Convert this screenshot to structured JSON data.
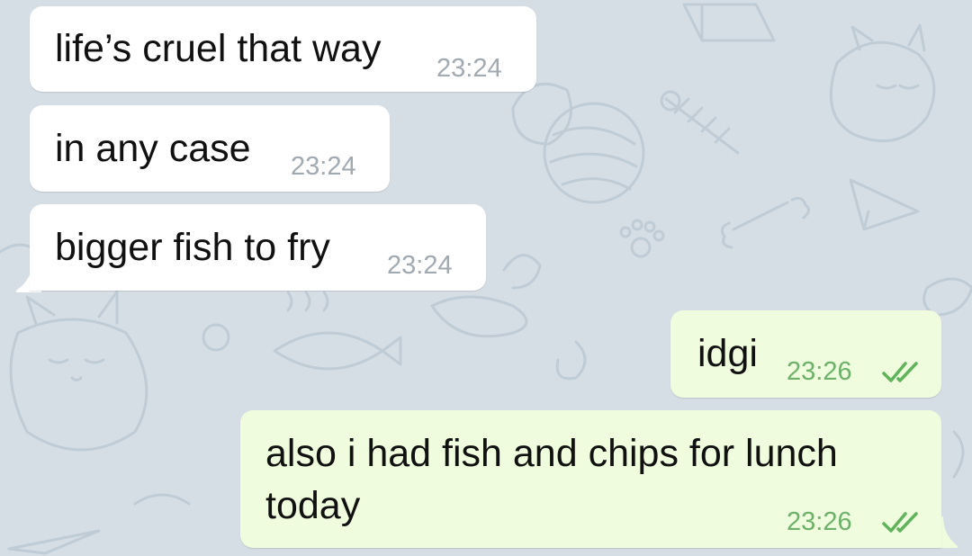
{
  "chat": {
    "messages": [
      {
        "text": "life’s cruel that way",
        "time": "23:24",
        "direction": "incoming"
      },
      {
        "text": "in any case",
        "time": "23:24",
        "direction": "incoming"
      },
      {
        "text": "bigger fish to fry",
        "time": "23:24",
        "direction": "incoming"
      },
      {
        "text": "idgi",
        "time": "23:26",
        "direction": "outgoing",
        "status_icon": "double-check-icon"
      },
      {
        "text_line1": "also i had fish and chips for lunch",
        "text_line2": "today",
        "time": "23:26",
        "direction": "outgoing",
        "status_icon": "double-check-icon"
      }
    ]
  },
  "colors": {
    "background": "#d6dee5",
    "incoming_bubble": "#ffffff",
    "outgoing_bubble": "#effdde",
    "outgoing_time": "#6db16a",
    "incoming_time": "#a1a9b1"
  }
}
